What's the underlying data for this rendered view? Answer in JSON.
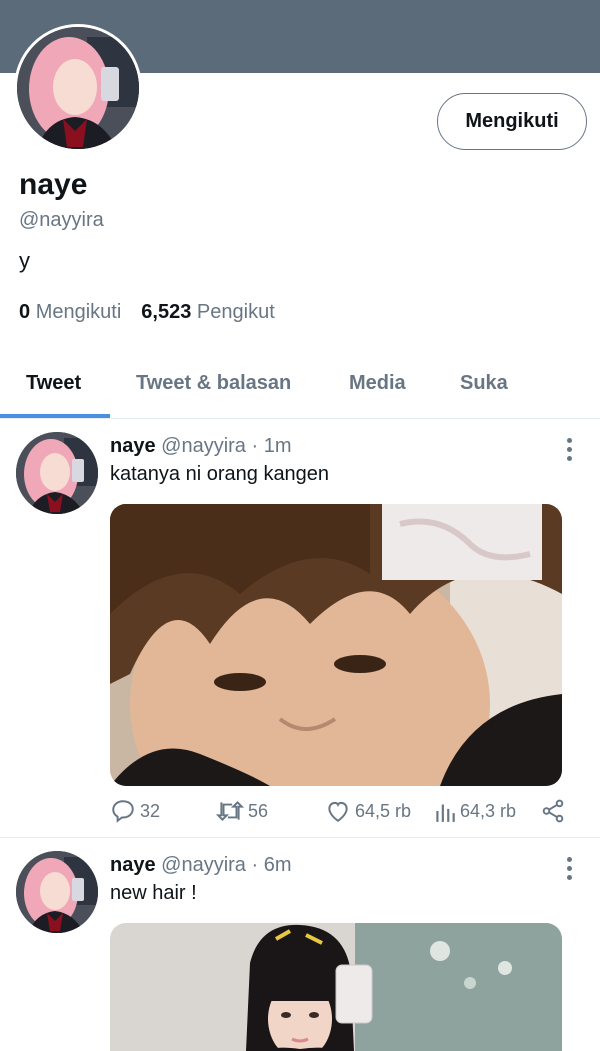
{
  "profile": {
    "name": "naye",
    "handle": "@nayyira",
    "bio": "y",
    "following_count": "0",
    "following_label": "Mengikuti",
    "followers_count": "6,523",
    "followers_label": "Pengikut",
    "follow_button": "Mengikuti"
  },
  "tabs": [
    "Tweet",
    "Tweet & balasan",
    "Media",
    "Suka"
  ],
  "colors": {
    "banner": "#5b6b7a",
    "accent": "#4a90e2",
    "muted": "#687684"
  },
  "tweets": [
    {
      "name": "naye",
      "handle": "@nayyira",
      "time": "· 1m",
      "text": "katanya ni orang kangen",
      "replies": "32",
      "retweets": "56",
      "likes": "64,5 rb",
      "views": "64,3 rb"
    },
    {
      "name": "naye",
      "handle": "@nayyira",
      "time": "· 6m",
      "text": "new hair !"
    }
  ],
  "icons": [
    "reply-icon",
    "retweet-icon",
    "like-icon",
    "views-icon",
    "share-icon",
    "more-icon"
  ]
}
